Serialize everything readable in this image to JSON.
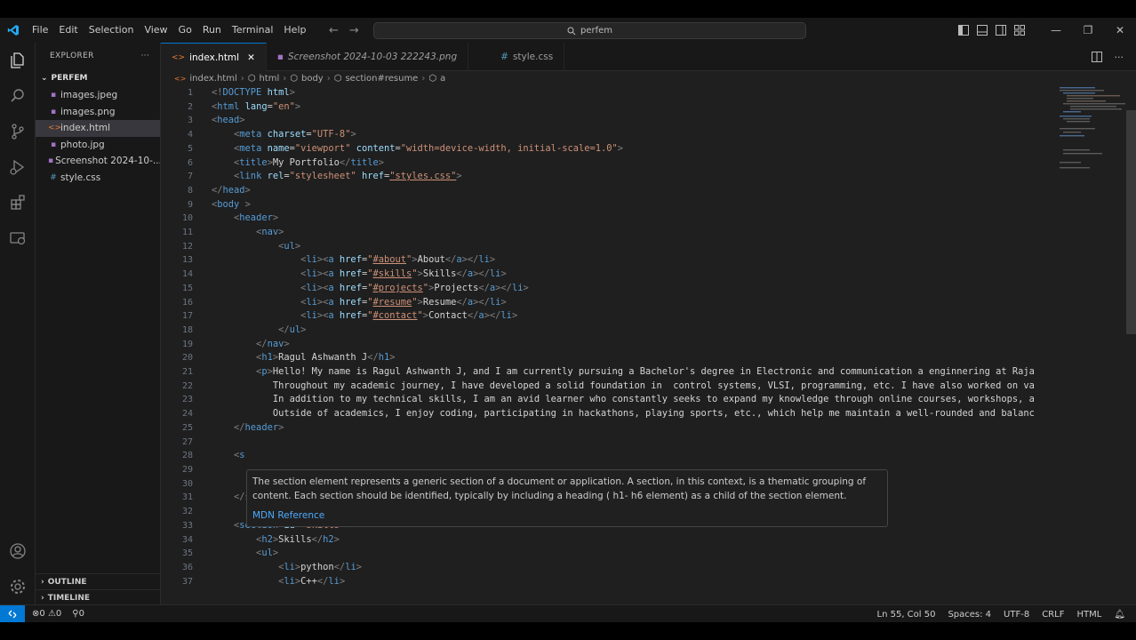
{
  "menu": [
    "File",
    "Edit",
    "Selection",
    "View",
    "Go",
    "Run",
    "Terminal",
    "Help"
  ],
  "search": "perfem",
  "explorer": {
    "title": "EXPLORER",
    "folder": "PERFEM",
    "files": [
      "images.jpeg",
      "images.png",
      "index.html",
      "photo.jpg",
      "Screenshot 2024-10-...",
      "style.css"
    ],
    "outline": "OUTLINE",
    "timeline": "TIMELINE"
  },
  "tabs": [
    "index.html",
    "Screenshot 2024-10-03 222243.png",
    "style.css"
  ],
  "breadcrumb": [
    "index.html",
    "html",
    "body",
    "section#resume",
    "a"
  ],
  "line_numbers": [
    "1",
    "2",
    "3",
    "4",
    "5",
    "6",
    "7",
    "8",
    "9",
    "10",
    "11",
    "12",
    "13",
    "14",
    "15",
    "16",
    "17",
    "18",
    "19",
    "20",
    "21",
    "22",
    "23",
    "24",
    "25",
    "27",
    "28",
    "29",
    "30",
    "31",
    "32",
    "33",
    "34",
    "35",
    "36",
    "37"
  ],
  "code": {
    "l21_text": "Hello! My name is Ragul Ashwanth J, and I am currently pursuing a Bachelor's degree in Electronic and communication a enginnering at Raja",
    "l22_text": "Throughout my academic journey, I have developed a solid foundation in  control systems, VLSI, programming, etc. I have also worked on va",
    "l23_text": "In addition to my technical skills, I am an avid learner who constantly seeks to expand my knowledge through online courses, workshops, a",
    "l24_text": "Outside of academics, I enjoy coding, participating in hackathons, playing sports, etc., which help me maintain a well-rounded and balanc"
  },
  "hover": {
    "text": "The section element represents a generic section of a document or application. A section, in this context, is a thematic grouping of content. Each section should be identified, typically by including a heading ( h1- h6 element) as a child of the section element.",
    "link": "MDN Reference"
  },
  "status": {
    "errors": "0",
    "warnings": "0",
    "ports": "0",
    "position": "Ln 55, Col 50",
    "spaces": "Spaces: 4",
    "encoding": "UTF-8",
    "eol": "CRLF",
    "language": "HTML"
  },
  "colors": {
    "accent": "#0078d4",
    "tag": "#569cd6",
    "attr": "#9cdcfe",
    "string": "#ce9178"
  }
}
